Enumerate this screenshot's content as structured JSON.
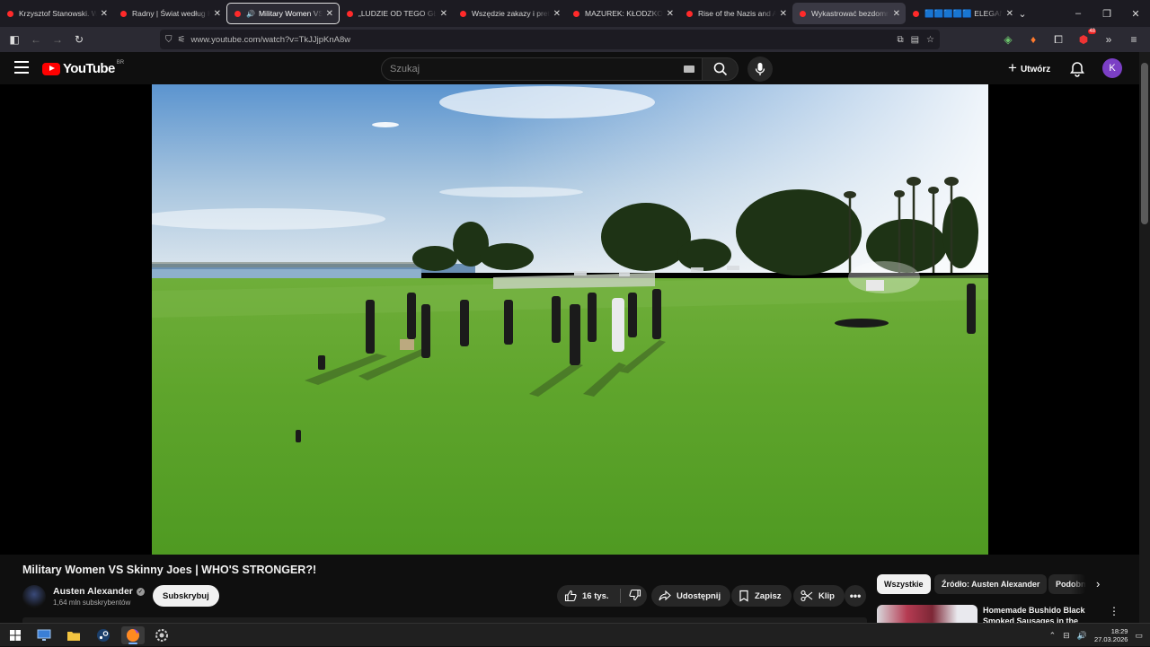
{
  "browser": {
    "tabs": [
      {
        "title": "Krzysztof Stanowski. W ja",
        "state": "normal"
      },
      {
        "title": "Radny | Świat według Kie",
        "state": "normal"
      },
      {
        "title": "Military Women VS Skinny",
        "state": "active",
        "audio": true
      },
      {
        "title": "„LUDZIE OD TEGO GŁUPI",
        "state": "normal"
      },
      {
        "title": "Wszędzie zakazy i pretens",
        "state": "normal"
      },
      {
        "title": "MAZUREK: KŁODZKO, PE",
        "state": "normal"
      },
      {
        "title": "Rise of the Nazis and Adol",
        "state": "normal"
      },
      {
        "title": "Wykastrować bezdomne",
        "state": "hover"
      },
      {
        "title": "🟦🟦🟦🟦🟦 ELEGANC",
        "state": "normal"
      }
    ],
    "url": "www.youtube.com/watch?v=TkJJjpKnA8w",
    "extension_badge_count": "48"
  },
  "youtube": {
    "logo_text": "YouTube",
    "logo_country": "BR",
    "search_placeholder": "Szukaj",
    "create_label": "Utwórz",
    "avatar_letter": "K",
    "brand_color": "#ff0000",
    "avatar_color": "#7b3fc5"
  },
  "video": {
    "title": "Military Women VS Skinny Joes | WHO'S STRONGER?!",
    "channel_name": "Austen Alexander",
    "subscribers": "1,64 mln subskrybentów",
    "subscribe_label": "Subskrybuj",
    "likes": "16 tys.",
    "share_label": "Udostępnij",
    "save_label": "Zapisz",
    "clip_label": "Klip"
  },
  "sidebar": {
    "chips": [
      "Wszystkie",
      "Źródło: Austen Alexander",
      "Podobne"
    ],
    "suggestion_title": "Homemade Bushido Black Smoked Sausages in the"
  },
  "taskbar": {
    "time": "18:29",
    "date": "27.03.2026"
  }
}
